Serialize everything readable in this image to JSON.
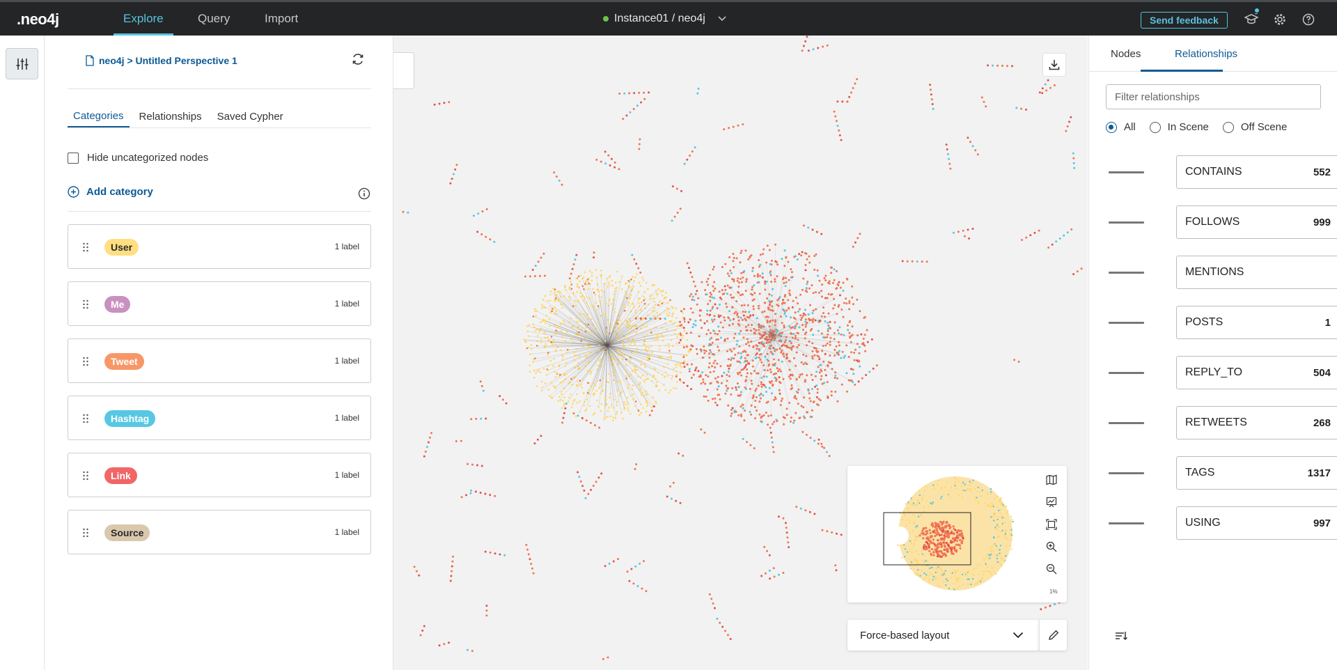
{
  "topbar": {
    "logo": "neo4j",
    "tabs": [
      {
        "label": "Explore",
        "active": true
      },
      {
        "label": "Query",
        "active": false
      },
      {
        "label": "Import",
        "active": false
      }
    ],
    "instance": "Instance01 / neo4j",
    "feedback_label": "Send feedback",
    "icons": [
      "graduation-cap-icon",
      "gear-icon",
      "help-icon"
    ],
    "colors": {
      "bg": "#232527",
      "accent": "#5bc2e0",
      "status": "#6cc24a"
    }
  },
  "perspective": {
    "breadcrumb": "neo4j > Untitled Perspective 1",
    "tabs": [
      {
        "label": "Categories",
        "active": true
      },
      {
        "label": "Relationships",
        "active": false
      },
      {
        "label": "Saved Cypher",
        "active": false
      }
    ],
    "hide_uncategorized_label": "Hide uncategorized nodes",
    "hide_uncategorized_checked": false,
    "add_category_label": "Add category",
    "categories": [
      {
        "name": "User",
        "count": "1 label",
        "color": "#ffdf81",
        "text": "#2a2a2a"
      },
      {
        "name": "Me",
        "count": "1 label",
        "color": "#c990c0",
        "text": "#ffffff"
      },
      {
        "name": "Tweet",
        "count": "1 label",
        "color": "#f79767",
        "text": "#ffffff"
      },
      {
        "name": "Hashtag",
        "count": "1 label",
        "color": "#57c7e3",
        "text": "#ffffff"
      },
      {
        "name": "Link",
        "count": "1 label",
        "color": "#f16667",
        "text": "#ffffff"
      },
      {
        "name": "Source",
        "count": "1 label",
        "color": "#d9c8ae",
        "text": "#2a2a2a"
      }
    ]
  },
  "canvas": {
    "minimap_zoom": "1%",
    "layout": "Force-based layout",
    "node_colors": {
      "user": "#ffd768",
      "tweet": "#f07653",
      "hashtag": "#57c7e3",
      "link": "#e3524e"
    }
  },
  "right_panel": {
    "tabs": [
      {
        "label": "Nodes",
        "active": false
      },
      {
        "label": "Relationships",
        "active": true
      }
    ],
    "filter_placeholder": "Filter relationships",
    "filter_value": "",
    "scope_options": [
      {
        "label": "All",
        "checked": true
      },
      {
        "label": "In Scene",
        "checked": false
      },
      {
        "label": "Off Scene",
        "checked": false
      }
    ],
    "relationships": [
      {
        "name": "CONTAINS",
        "count": "552"
      },
      {
        "name": "FOLLOWS",
        "count": "999"
      },
      {
        "name": "MENTIONS",
        "count": ""
      },
      {
        "name": "POSTS",
        "count": "1"
      },
      {
        "name": "REPLY_TO",
        "count": "504"
      },
      {
        "name": "RETWEETS",
        "count": "268"
      },
      {
        "name": "TAGS",
        "count": "1317"
      },
      {
        "name": "USING",
        "count": "997"
      }
    ]
  }
}
